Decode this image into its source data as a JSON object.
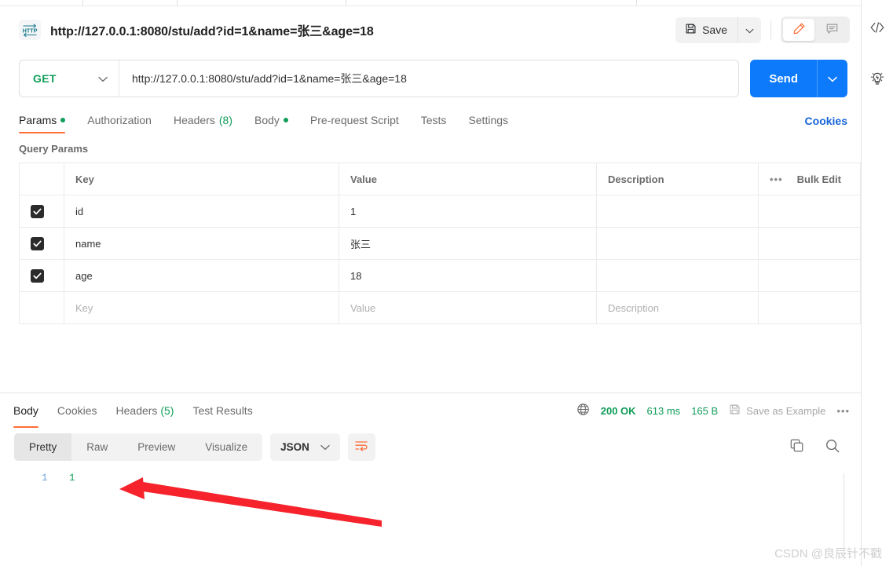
{
  "header": {
    "icon": "http-protocol-icon",
    "title": "http://127.0.0.1:8080/stu/add?id=1&name=张三&age=18",
    "save_label": "Save",
    "save_icon": "floppy-disk-icon",
    "save_caret_icon": "chevron-down-icon",
    "edit_icon": "pencil-icon",
    "comment_icon": "comment-icon"
  },
  "request": {
    "method": "GET",
    "method_caret_icon": "chevron-down-icon",
    "url": "http://127.0.0.1:8080/stu/add?id=1&name=张三&age=18",
    "send_label": "Send",
    "send_caret_icon": "chevron-down-icon"
  },
  "request_tabs": [
    {
      "label": "Params",
      "dot": true,
      "active": true
    },
    {
      "label": "Authorization",
      "dot": false,
      "active": false
    },
    {
      "label": "Headers",
      "count": "(8)",
      "dot": false,
      "active": false
    },
    {
      "label": "Body",
      "dot": true,
      "active": false
    },
    {
      "label": "Pre-request Script",
      "dot": false,
      "active": false
    },
    {
      "label": "Tests",
      "dot": false,
      "active": false
    },
    {
      "label": "Settings",
      "dot": false,
      "active": false
    }
  ],
  "cookies_link": "Cookies",
  "params": {
    "section_title": "Query Params",
    "columns": [
      "Key",
      "Value",
      "Description"
    ],
    "more_icon": "ellipsis-icon",
    "bulk_edit": "Bulk Edit",
    "rows": [
      {
        "checked": true,
        "key": "id",
        "value": "1",
        "description": ""
      },
      {
        "checked": true,
        "key": "name",
        "value": "张三",
        "description": ""
      },
      {
        "checked": true,
        "key": "age",
        "value": "18",
        "description": ""
      }
    ],
    "placeholder_row": {
      "key": "Key",
      "value": "Value",
      "description": "Description"
    }
  },
  "response_tabs": [
    {
      "label": "Body",
      "active": true
    },
    {
      "label": "Cookies",
      "active": false
    },
    {
      "label": "Headers",
      "count": "(5)",
      "active": false
    },
    {
      "label": "Test Results",
      "active": false
    }
  ],
  "response_meta": {
    "globe_icon": "globe-icon",
    "status": "200 OK",
    "time": "613 ms",
    "size": "165 B",
    "save_example_icon": "floppy-disk-icon",
    "save_example": "Save as Example",
    "more_icon": "ellipsis-icon"
  },
  "response_toolbar": {
    "formats": [
      {
        "label": "Pretty",
        "active": true
      },
      {
        "label": "Raw",
        "active": false
      },
      {
        "label": "Preview",
        "active": false
      },
      {
        "label": "Visualize",
        "active": false
      }
    ],
    "language": "JSON",
    "language_caret_icon": "chevron-down-icon",
    "wrap_icon": "word-wrap-icon",
    "copy_icon": "copy-icon",
    "search_icon": "search-icon"
  },
  "response_body": {
    "line_number": "1",
    "content": "1"
  },
  "right_rail": [
    {
      "icon": "code-icon"
    },
    {
      "icon": "lightbulb-icon"
    }
  ],
  "watermark": "CSDN @良辰针不戳",
  "colors": {
    "accent_orange": "#ff6c37",
    "send_blue": "#0d7afc",
    "success_green": "#0f9d58",
    "link_blue": "#1664d8",
    "annotation_red": "#f6232c"
  }
}
